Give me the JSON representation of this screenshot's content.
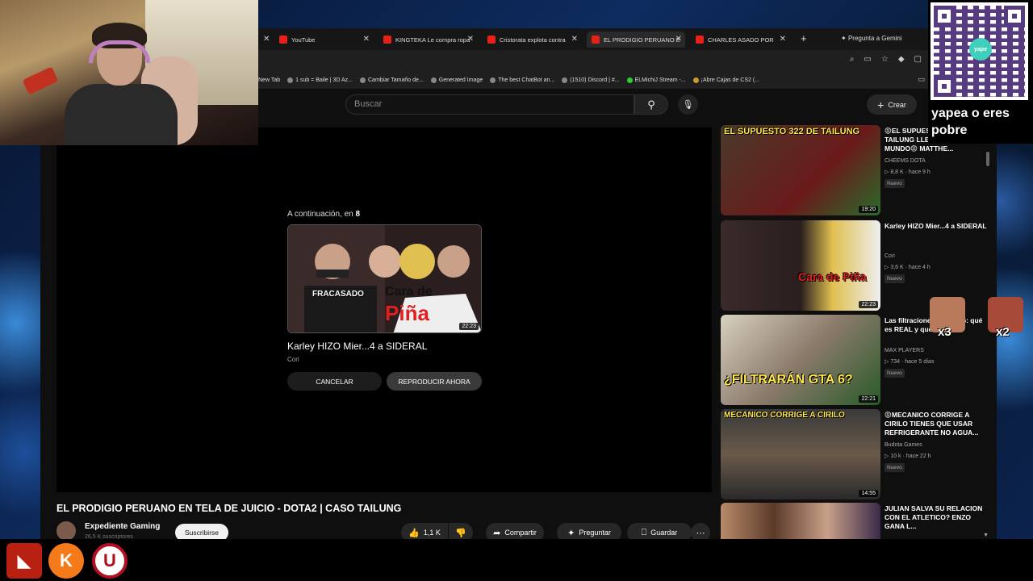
{
  "browser": {
    "tabs": [
      {
        "label": "YouTube"
      },
      {
        "label": "KINGTEKA Le compra ropa"
      },
      {
        "label": "Cristorata explota contra"
      },
      {
        "label": "EL PRODIGIO PERUANO E"
      },
      {
        "label": "CHARLES ASADO POR"
      }
    ],
    "gemini_label": "Pregunta a Gemini",
    "bookmarks": [
      "New Tab",
      "1 sub = Baile | 3D Az...",
      "Cambiar Tamaño de...",
      "Generated Image",
      "The best ChatBot an...",
      "(1510) Discord | #...",
      "ELMichiJ Stream -...",
      "¡Abre Cajas de CS2 (..."
    ]
  },
  "youtube": {
    "search_placeholder": "Buscar",
    "create_label": "Crear",
    "player": {
      "upnext_prefix": "A continuación, en",
      "upnext_seconds": "8",
      "upnext_title": "Karley HIZO Mier...4 a SIDERAL",
      "upnext_channel": "Cori",
      "upnext_duration": "22:23",
      "upnext_thumb_text_1": "FRACASADO",
      "upnext_thumb_text_2": "Cara de",
      "upnext_thumb_text_3": "Piña",
      "cancel_label": "CANCELAR",
      "play_now_label": "REPRODUCIR AHORA"
    },
    "video": {
      "title": "EL PRODIGIO PERUANO EN TELA DE JUICIO - DOTA2 | CASO TAILUNG",
      "channel_name": "Expediente Gaming",
      "channel_subs": "26,5 K suscriptores",
      "subscribe_label": "Suscribirse",
      "likes": "1,1 K",
      "share_label": "Compartir",
      "ask_label": "Preguntar",
      "save_label": "Guardar"
    },
    "sidebar": [
      {
        "title": "😡EL SUPUESTO 322 DE TAILUNG LLEGA A OÍDOS DEL MUNDO😡 MATTHE...",
        "channel": "CHEEMS DOTA",
        "views": "8,8 K",
        "age": "hace 9 h",
        "badge": "Nuevo",
        "duration": "19:20",
        "thumb_text": "EL SUPUESTO 322 DE TAILUNG"
      },
      {
        "title": "Karley HIZO Mier...4 a SIDERAL",
        "channel": "Cori",
        "views": "3,6 K",
        "age": "hace 4 h",
        "badge": "Nuevo",
        "duration": "22:23",
        "thumb_text": "Cara de Piña"
      },
      {
        "title": "Las filtraciones de GTA 6: qué es REAL y qué es FAKE",
        "channel": "MAX PLAYERS",
        "views": "734",
        "age": "hace 5 días",
        "badge": "Nuevo",
        "duration": "22:21",
        "thumb_text": "¿FILTRARÁN GTA 6?"
      },
      {
        "title": "😡MECANICO CORRIGE A CIRILO TIENES QUE USAR REFRIGERANTE NO AGUA...",
        "channel": "Budota Games",
        "views": "10 k",
        "age": "hace 22 h",
        "badge": "Nuevo",
        "duration": "14:55",
        "thumb_text": "MECANICO CORRIGE A CIRILO"
      },
      {
        "title": "JULIAN SALVA SU RELACION CON EL ATLETICO? ENZO GANA L...",
        "channel": "",
        "views": "",
        "age": "",
        "badge": "",
        "duration": "",
        "thumb_text": ""
      }
    ]
  },
  "overlay": {
    "qr_logo": "yape",
    "qr_caption": "yapea o eres pobre",
    "emote_count_1": "x3",
    "emote_count_2": "x2"
  },
  "colors": {
    "yt_bg": "#0f0f0f",
    "accent_red": "#e62117",
    "thumb_yellow": "#ffe84a"
  }
}
